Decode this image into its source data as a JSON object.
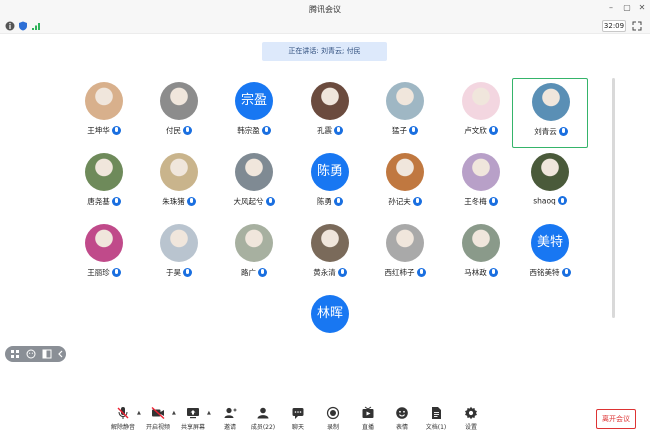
{
  "window": {
    "title": "腾讯会议"
  },
  "status": {
    "time": "32:09"
  },
  "speaking": {
    "text": "正在讲话: 刘青云; 付民"
  },
  "participants": [
    {
      "name": "王坤华",
      "avatar_text": "",
      "avatar_color": "#d8b08c"
    },
    {
      "name": "付民",
      "avatar_text": "",
      "avatar_color": "#8c8c8c"
    },
    {
      "name": "韩宗盈",
      "avatar_text": "宗盈",
      "avatar_color": "#1877f2"
    },
    {
      "name": "孔震",
      "avatar_text": "",
      "avatar_color": "#6b4b3e"
    },
    {
      "name": "猛子",
      "avatar_text": "",
      "avatar_color": "#9fb7c4"
    },
    {
      "name": "卢文欣",
      "avatar_text": "",
      "avatar_color": "#f3d6e0"
    },
    {
      "name": "刘青云",
      "avatar_text": "",
      "avatar_color": "#5a8fb5"
    },
    {
      "name": "唐尧基",
      "avatar_text": "",
      "avatar_color": "#6e8a5a"
    },
    {
      "name": "朱珠猪",
      "avatar_text": "",
      "avatar_color": "#c9b48c"
    },
    {
      "name": "大风起兮",
      "avatar_text": "",
      "avatar_color": "#7f8a93"
    },
    {
      "name": "陈勇",
      "avatar_text": "陈勇",
      "avatar_color": "#1877f2"
    },
    {
      "name": "孙记夫",
      "avatar_text": "",
      "avatar_color": "#c07840"
    },
    {
      "name": "王冬梅",
      "avatar_text": "",
      "avatar_color": "#b8a0c8"
    },
    {
      "name": "shaoq",
      "avatar_text": "",
      "avatar_color": "#4a5a3a"
    },
    {
      "name": "王丽珍",
      "avatar_text": "",
      "avatar_color": "#c04a8a"
    },
    {
      "name": "于昊",
      "avatar_text": "",
      "avatar_color": "#b9c4cf"
    },
    {
      "name": "路广",
      "avatar_text": "",
      "avatar_color": "#a7b0a0"
    },
    {
      "name": "黄永清",
      "avatar_text": "",
      "avatar_color": "#7a6a5a"
    },
    {
      "name": "西红柿子",
      "avatar_text": "",
      "avatar_color": "#a9a9a9"
    },
    {
      "name": "马林政",
      "avatar_text": "",
      "avatar_color": "#8a9a8a"
    },
    {
      "name": "西铭美特",
      "avatar_text": "美特",
      "avatar_color": "#1877f2"
    },
    {
      "name": "",
      "avatar_text": "林晖",
      "avatar_color": "#1877f2"
    }
  ],
  "toolbar": {
    "items": [
      {
        "label": "解除静音",
        "icon": "mic-muted-icon"
      },
      {
        "label": "开启视频",
        "icon": "video-off-icon"
      },
      {
        "label": "共享屏幕",
        "icon": "share-screen-icon"
      },
      {
        "label": "邀请",
        "icon": "invite-icon"
      },
      {
        "label": "成员(22)",
        "icon": "members-icon"
      },
      {
        "label": "聊天",
        "icon": "chat-icon"
      },
      {
        "label": "录制",
        "icon": "record-icon"
      },
      {
        "label": "直播",
        "icon": "live-icon"
      },
      {
        "label": "表情",
        "icon": "emoji-icon"
      },
      {
        "label": "文档(1)",
        "icon": "document-icon"
      },
      {
        "label": "设置",
        "icon": "settings-icon"
      }
    ],
    "leave_label": "离开会议"
  },
  "colors": {
    "accent": "#1877f2",
    "active_border": "#35b46a",
    "danger": "#dd3333"
  }
}
